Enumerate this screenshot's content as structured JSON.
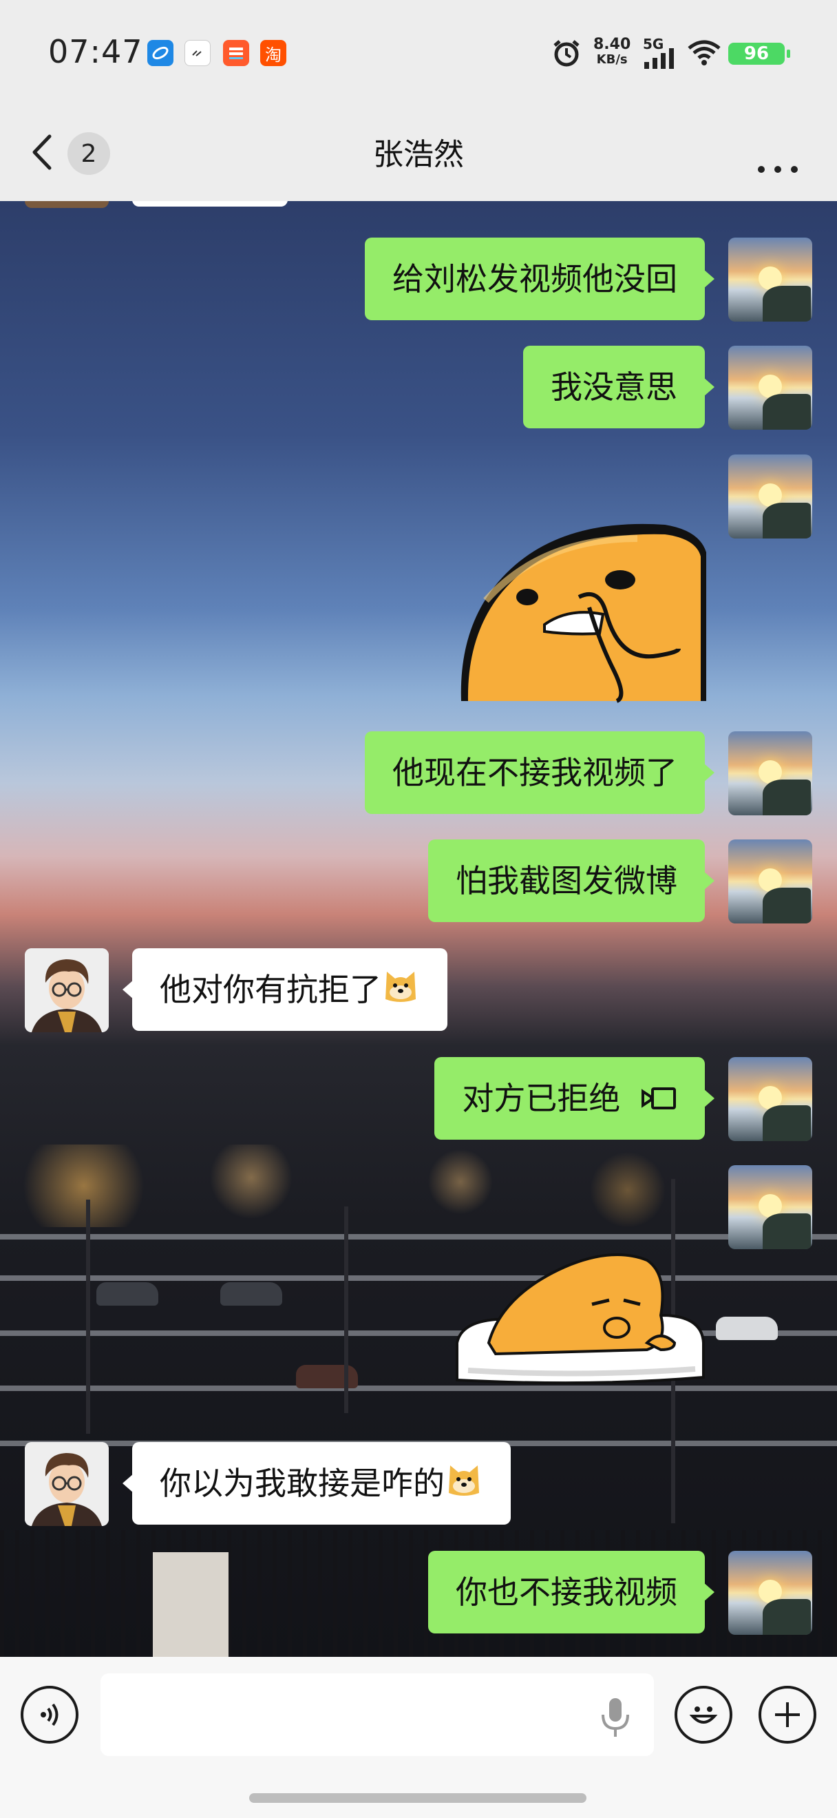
{
  "status_bar": {
    "time": "07:47",
    "app_icons": [
      "browser-icon",
      "clock-app-icon",
      "shopping-app-icon",
      "taobao-icon"
    ],
    "taobao_label": "淘",
    "net_speed_value": "8.40",
    "net_speed_unit": "KB/s",
    "network": "5G",
    "battery": "96",
    "colors": {
      "battery": "#4cd964"
    }
  },
  "header": {
    "back_count": "2",
    "title": "张浩然",
    "more_icon": "more-dots-icon"
  },
  "messages": [
    {
      "id": "m1",
      "sender": "me",
      "type": "text",
      "text": "给刘松发视频他没回"
    },
    {
      "id": "m2",
      "sender": "me",
      "type": "text",
      "text": "我没意思"
    },
    {
      "id": "m3",
      "sender": "me",
      "type": "sticker",
      "sticker": "gudetama-thinking-sticker"
    },
    {
      "id": "m4",
      "sender": "me",
      "type": "text",
      "text": "他现在不接我视频了"
    },
    {
      "id": "m5",
      "sender": "me",
      "type": "text",
      "text": "怕我截图发微博"
    },
    {
      "id": "m6",
      "sender": "friend",
      "type": "text",
      "text": "他对你有抗拒了",
      "emoji": "doge-emoji"
    },
    {
      "id": "m7",
      "sender": "me",
      "type": "call",
      "text": "对方已拒绝",
      "icon": "video-call-icon"
    },
    {
      "id": "m8",
      "sender": "me",
      "type": "sticker",
      "sticker": "gudetama-lying-sticker"
    },
    {
      "id": "m9",
      "sender": "friend",
      "type": "text",
      "text": "你以为我敢接是咋的",
      "emoji": "doge-emoji"
    },
    {
      "id": "m10",
      "sender": "me",
      "type": "text",
      "text": "你也不接我视频"
    }
  ],
  "input_bar": {
    "voice_icon": "voice-mode-icon",
    "mic_icon": "microphone-icon",
    "emoji_icon": "emoji-face-icon",
    "plus_icon": "plus-icon",
    "input_value": ""
  },
  "colors": {
    "my_bubble": "#95ec69",
    "friend_bubble": "#ffffff",
    "bar_background": "#ededed"
  }
}
